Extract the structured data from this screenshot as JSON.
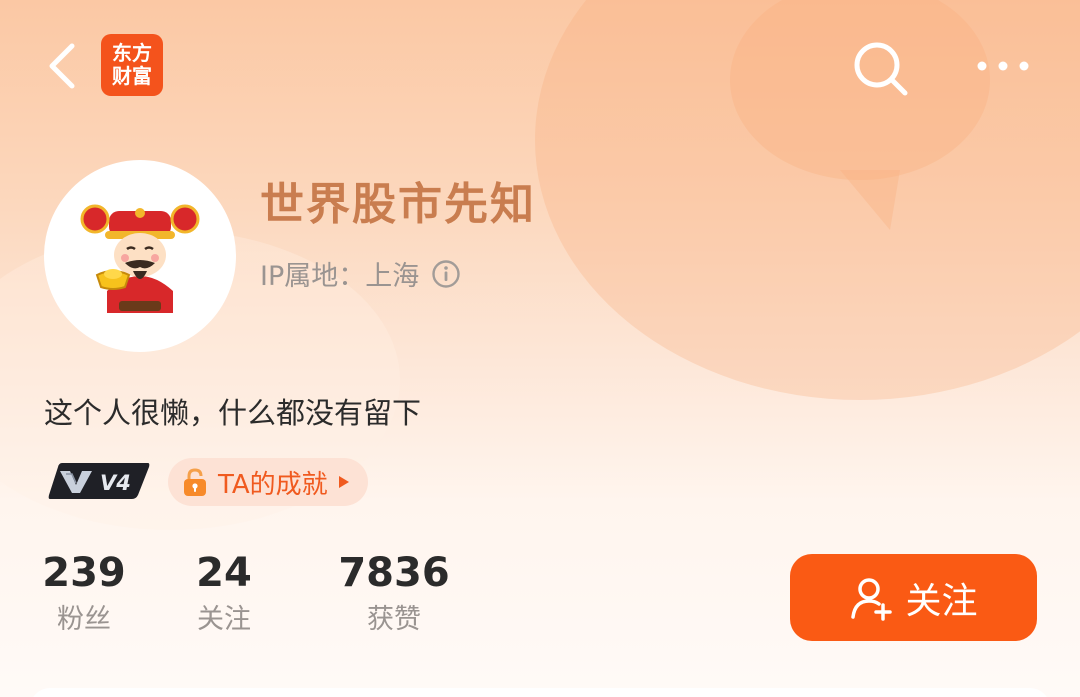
{
  "header": {
    "logo_line1": "东方",
    "logo_line2": "财富",
    "back_icon": "chevron-left-icon",
    "search_icon": "search-icon",
    "more_icon": "more-horizontal-icon"
  },
  "profile": {
    "name": "世界股市先知",
    "ip_location": "IP属地：上海",
    "bio": "这个人很懒，什么都没有留下",
    "level_badge": "V4",
    "achievement_label": "TA的成就"
  },
  "stats": [
    {
      "value": "239",
      "label": "粉丝"
    },
    {
      "value": "24",
      "label": "关注"
    },
    {
      "value": "7836",
      "label": "获赞"
    }
  ],
  "follow_button": {
    "label": "关注"
  },
  "colors": {
    "accent": "#fa5a14",
    "logo_bg": "#f4531c",
    "name_color": "#c97d4f",
    "achievement_bg": "#fde2d5"
  }
}
